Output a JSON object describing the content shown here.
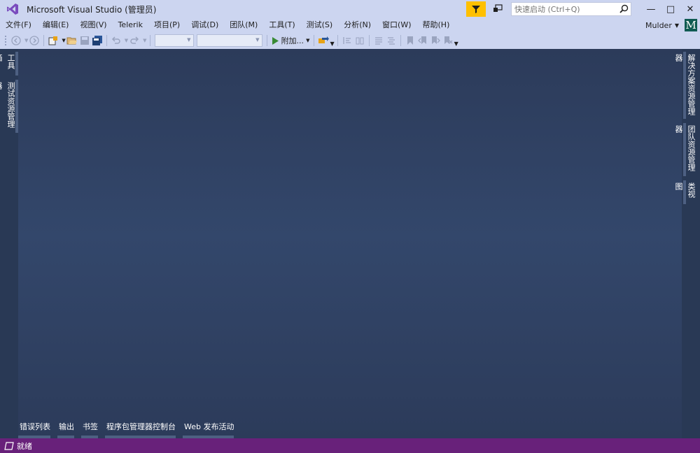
{
  "window": {
    "title": "Microsoft Visual Studio (管理员)",
    "logo_icon": "visual-studio-logo-icon",
    "brand_color": "#68217a",
    "accent_filter_color": "#ffc000",
    "minimize_glyph": "—",
    "maximize_glyph": "□",
    "close_glyph": "✕"
  },
  "quick_launch": {
    "placeholder": "快速启动 (Ctrl+Q)",
    "icon": "search-icon"
  },
  "menu": {
    "items": [
      "文件(F)",
      "编辑(E)",
      "视图(V)",
      "Telerik",
      "项目(P)",
      "调试(D)",
      "团队(M)",
      "工具(T)",
      "测试(S)",
      "分析(N)",
      "窗口(W)",
      "帮助(H)"
    ]
  },
  "account": {
    "user_name": "Mulder",
    "avatar_letter": "M",
    "avatar_color": "#0f5a52"
  },
  "toolbar": {
    "start_label": "附加...",
    "start_icon": "play-icon",
    "config_combo_value": "",
    "platform_combo_value": ""
  },
  "left_tabs": [
    "工具箱",
    "测试资源管理器"
  ],
  "right_tabs": [
    "解决方案资源管理器",
    "团队资源管理器",
    "类视图"
  ],
  "bottom_tabs": [
    "错误列表",
    "输出",
    "书签",
    "程序包管理器控制台",
    "Web 发布活动"
  ],
  "status": {
    "text": "就绪",
    "icon": "notification-icon"
  }
}
